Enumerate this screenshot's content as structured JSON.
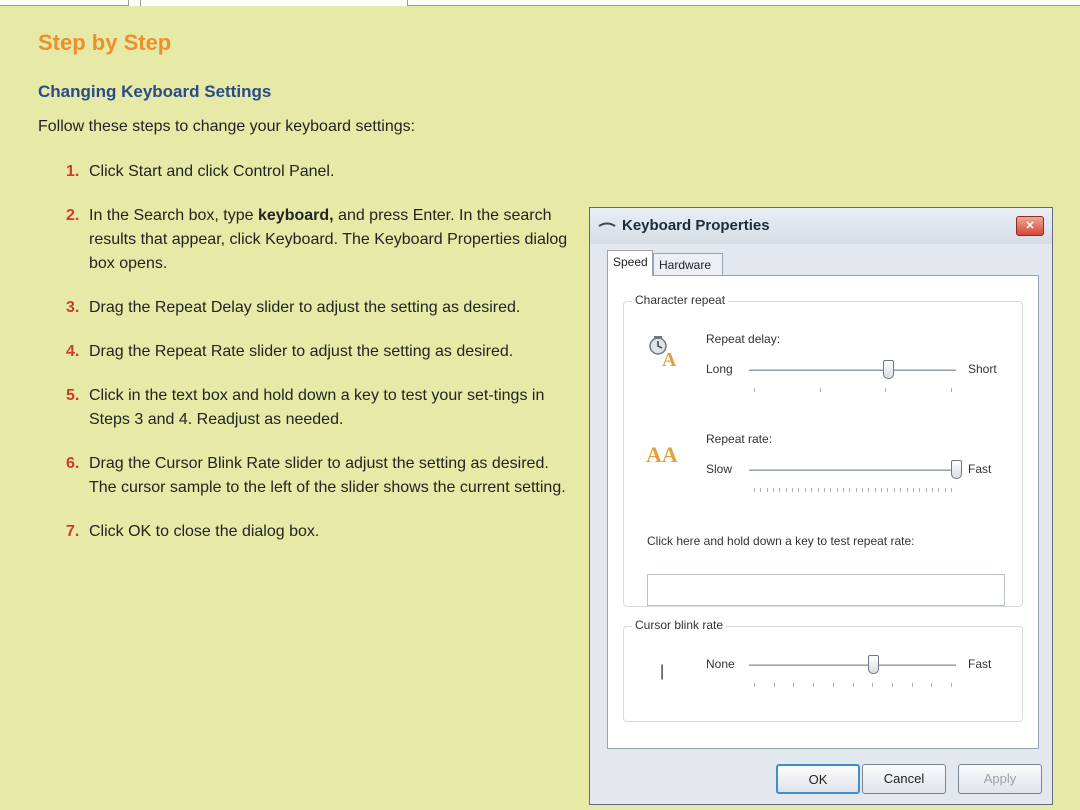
{
  "box": {
    "heading": "Step by Step",
    "section_title": "Changing Keyboard Settings",
    "intro": "Follow these steps to change your keyboard settings:",
    "steps": [
      {
        "num": "1.",
        "text": "Click Start and click Control Panel."
      },
      {
        "num": "2.",
        "text_before": "In the Search box, type ",
        "bold": "keyboard,",
        "text_after": " and press Enter. In the search results that appear, click Keyboard. The Keyboard Properties dialog box opens."
      },
      {
        "num": "3.",
        "text": "Drag the Repeat Delay slider to adjust the setting as desired."
      },
      {
        "num": "4.",
        "text": "Drag the Repeat Rate slider to adjust the setting as desired."
      },
      {
        "num": "5.",
        "text": "Click in the text box and hold down a key to test your set-tings in Steps 3 and 4. Readjust as needed."
      },
      {
        "num": "6.",
        "text": "Drag the Cursor Blink Rate slider to adjust the setting as desired. The cursor sample to the left of the slider shows the current setting."
      },
      {
        "num": "7.",
        "text": "Click OK to close the dialog box."
      }
    ]
  },
  "dialog": {
    "title": "Keyboard Properties",
    "close_glyph": "✕",
    "tabs": [
      "Speed",
      "Hardware"
    ],
    "active_tab": "Speed",
    "character_repeat": {
      "legend": "Character repeat",
      "repeat_delay": {
        "label": "Repeat delay:",
        "min_label": "Long",
        "max_label": "Short",
        "icon_text": "A",
        "value_fraction": 0.67
      },
      "repeat_rate": {
        "label": "Repeat rate:",
        "min_label": "Slow",
        "max_label": "Fast",
        "icon_text": "AA",
        "value_fraction": 1.0
      },
      "test_label": "Click here and hold down a key to test repeat rate:",
      "test_value": ""
    },
    "cursor_blink": {
      "legend": "Cursor blink rate",
      "min_label": "None",
      "max_label": "Fast",
      "cursor_sample": "|",
      "value_fraction": 0.6
    },
    "buttons": {
      "ok": "OK",
      "cancel": "Cancel",
      "apply": "Apply"
    }
  },
  "colors": {
    "background": "#e6eaa6",
    "heading": "#ef8f2c",
    "section_title": "#2b4a8a",
    "step_number": "#cf3b2b"
  }
}
